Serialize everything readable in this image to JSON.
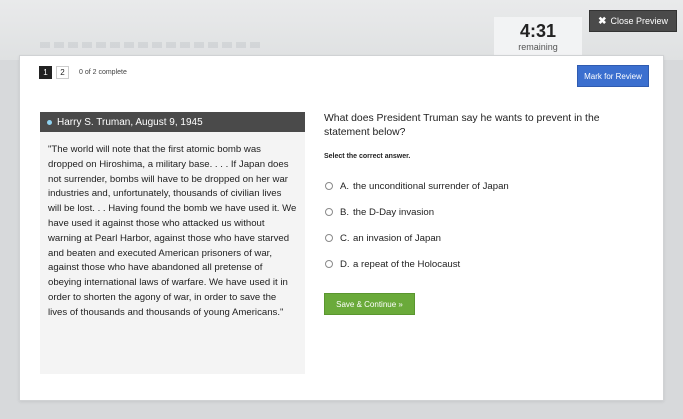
{
  "colors": {
    "accent_blue": "#3b6fcf",
    "save_green": "#6aaa3a",
    "header_dark": "#4a4a4a"
  },
  "top_bar": {
    "close_label": "Close Preview",
    "close_icon": "x-icon"
  },
  "timer": {
    "time": "4:31",
    "label": "remaining"
  },
  "pager": {
    "pages": [
      "1",
      "2"
    ],
    "active_page": "1",
    "progress": "0 of 2 complete"
  },
  "mark_review_label": "Mark for Review",
  "source": {
    "title": "Harry S. Truman, August 9, 1945",
    "text": "\"The world will note that the first atomic bomb was dropped on Hiroshima, a military base. . . . If Japan does not surrender, bombs will have to be dropped on her war industries and, unfortunately, thousands of civilian lives will be lost. . . Having found the bomb we have used it. We have used it against those who attacked us without warning at Pearl Harbor, against those who have starved and beaten and executed American prisoners of war, against those who have abandoned all pretense of obeying international laws of warfare. We have used it in order to shorten the agony of war, in order to save the lives of thousands and thousands of young Americans.\""
  },
  "question": {
    "prompt": "What does President Truman say he wants to prevent in the statement below?",
    "instruction": "Select the correct answer.",
    "options": [
      {
        "letter": "A.",
        "text": "the unconditional surrender of Japan"
      },
      {
        "letter": "B.",
        "text": "the D-Day invasion"
      },
      {
        "letter": "C.",
        "text": "an invasion of Japan"
      },
      {
        "letter": "D.",
        "text": "a repeat of the Holocaust"
      }
    ],
    "submit_label": "Save & Continue »"
  }
}
